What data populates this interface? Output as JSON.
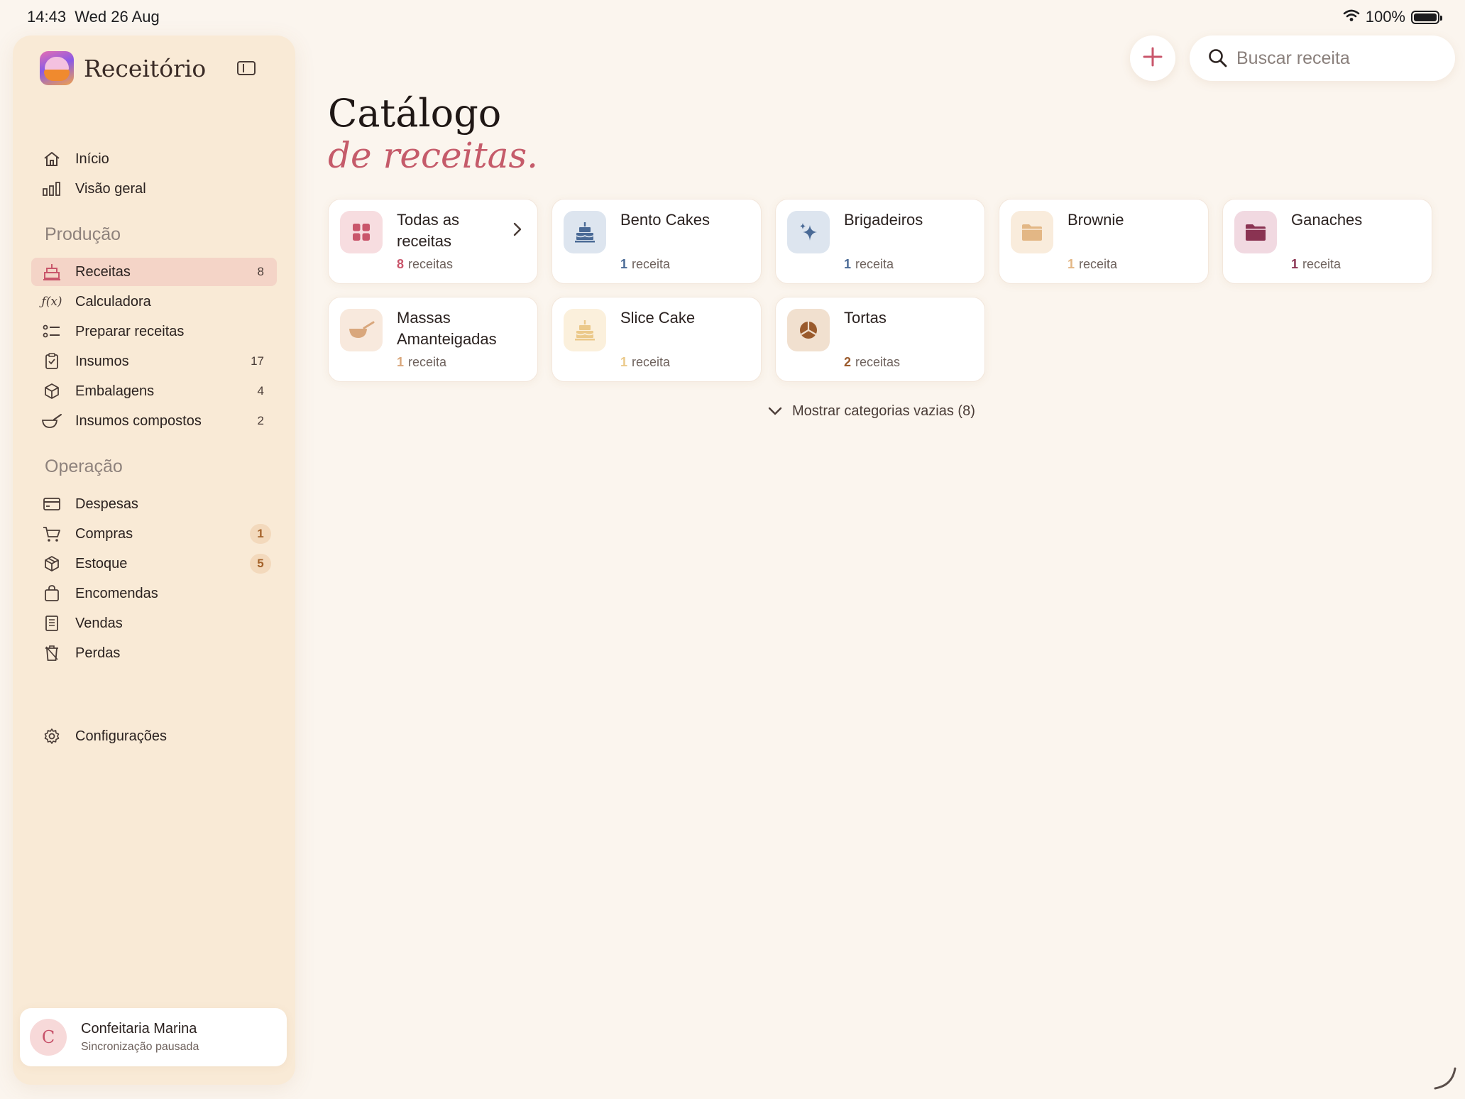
{
  "status_bar": {
    "time": "14:43",
    "date": "Wed 26 Aug",
    "battery": "100%"
  },
  "sidebar": {
    "app_name": "Receitório",
    "top_items": [
      {
        "label": "Início",
        "icon": "house-icon"
      },
      {
        "label": "Visão geral",
        "icon": "bar-chart-icon"
      }
    ],
    "sections": [
      {
        "title": "Produção",
        "items": [
          {
            "label": "Receitas",
            "icon": "cake-icon",
            "count": "8",
            "active": true
          },
          {
            "label": "Calculadora",
            "icon": "function-icon"
          },
          {
            "label": "Preparar receitas",
            "icon": "checklist-icon"
          },
          {
            "label": "Insumos",
            "icon": "clipboard-icon",
            "count": "17"
          },
          {
            "label": "Embalagens",
            "icon": "box-icon",
            "count": "4"
          },
          {
            "label": "Insumos compostos",
            "icon": "mixing-bowl-icon",
            "count": "2"
          }
        ]
      },
      {
        "title": "Operação",
        "items": [
          {
            "label": "Despesas",
            "icon": "credit-card-icon"
          },
          {
            "label": "Compras",
            "icon": "cart-icon",
            "badge": "1"
          },
          {
            "label": "Estoque",
            "icon": "package-icon",
            "badge": "5"
          },
          {
            "label": "Encomendas",
            "icon": "bag-icon"
          },
          {
            "label": "Vendas",
            "icon": "receipt-icon"
          },
          {
            "label": "Perdas",
            "icon": "trash-icon"
          }
        ]
      }
    ],
    "settings": {
      "label": "Configurações",
      "icon": "gear-icon"
    },
    "profile": {
      "initial": "C",
      "name": "Confeitaria Marina",
      "status": "Sincronização pausada"
    }
  },
  "search": {
    "placeholder": "Buscar receita"
  },
  "page": {
    "title": "Catálogo",
    "subtitle": "de receitas."
  },
  "categories": [
    {
      "title": "Todas as receitas",
      "count": "8",
      "unit": "receitas",
      "icon": "grid-icon",
      "color": "#c9566b",
      "bg": "#f7dde0",
      "chevron": true
    },
    {
      "title": "Bento Cakes",
      "count": "1",
      "unit": "receita",
      "icon": "cake-icon",
      "color": "#4a6a96",
      "bg": "#dde5ef"
    },
    {
      "title": "Brigadeiros",
      "count": "1",
      "unit": "receita",
      "icon": "sparkles-icon",
      "color": "#4a6a96",
      "bg": "#dde5ef"
    },
    {
      "title": "Brownie",
      "count": "1",
      "unit": "receita",
      "icon": "folder-icon",
      "color": "#e3b785",
      "bg": "#f9ecdc"
    },
    {
      "title": "Ganaches",
      "count": "1",
      "unit": "receita",
      "icon": "folder-icon",
      "color": "#8a3352",
      "bg": "#f1d9e1"
    },
    {
      "title": "Massas Amanteigadas",
      "count": "1",
      "unit": "receita",
      "icon": "mixing-bowl-icon",
      "color": "#d9a77c",
      "bg": "#f8e9dd"
    },
    {
      "title": "Slice Cake",
      "count": "1",
      "unit": "receita",
      "icon": "cake-icon",
      "color": "#ebc98a",
      "bg": "#fbf0dc"
    },
    {
      "title": "Tortas",
      "count": "2",
      "unit": "receitas",
      "icon": "pie-chart-icon",
      "color": "#9a5a2c",
      "bg": "#f1e0cf"
    }
  ],
  "show_empty": {
    "label": "Mostrar categorias vazias (8)"
  },
  "colors": {
    "accent": "#c55b6a",
    "background": "#fbf5ee",
    "sidebar": "#f9ead6"
  }
}
